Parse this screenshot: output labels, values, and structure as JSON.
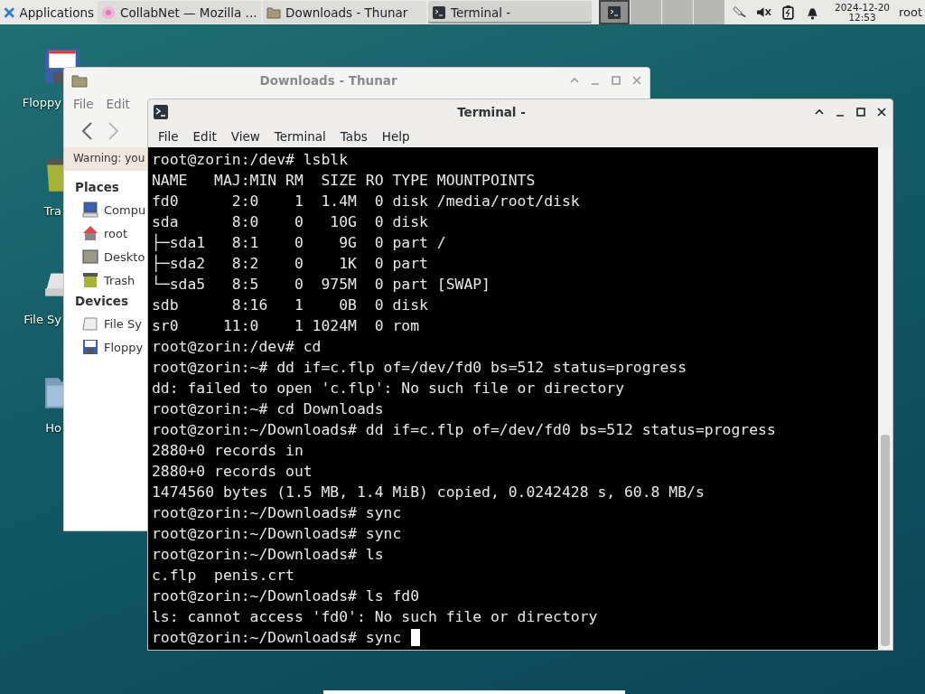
{
  "taskbar": {
    "applications": "Applications",
    "tasks": [
      {
        "label": "CollabNet — Mozilla ...",
        "kind": "browser",
        "selected": false
      },
      {
        "label": "Downloads - Thunar",
        "kind": "folder",
        "selected": false
      },
      {
        "label": "Terminal -",
        "kind": "terminal",
        "selected": true
      }
    ],
    "clock": {
      "date": "2024-12-20",
      "time": "12:53"
    },
    "user": "root"
  },
  "desktop_icons": [
    {
      "label": "Floppy",
      "kind": "floppy"
    },
    {
      "label": "Tra",
      "kind": "trash"
    },
    {
      "label": "File Sy",
      "kind": "drive"
    },
    {
      "label": "Ho",
      "kind": "folder"
    }
  ],
  "thunar": {
    "title": "Downloads - Thunar",
    "menu": [
      "File",
      "Edit"
    ],
    "warning": "Warning: you",
    "sidebar": [
      {
        "heading": "Places",
        "items": [
          {
            "label": "Compu",
            "kind": "computer"
          },
          {
            "label": "root",
            "kind": "home"
          },
          {
            "label": "Deskto",
            "kind": "desktop"
          },
          {
            "label": "Trash",
            "kind": "trash"
          }
        ]
      },
      {
        "heading": "Devices",
        "items": [
          {
            "label": "File Sy",
            "kind": "drive"
          },
          {
            "label": "Floppy",
            "kind": "floppy"
          }
        ]
      }
    ]
  },
  "terminal": {
    "title": "Terminal -",
    "menu": [
      "File",
      "Edit",
      "View",
      "Terminal",
      "Tabs",
      "Help"
    ],
    "lines": [
      "root@zorin:/dev# lsblk",
      "NAME   MAJ:MIN RM  SIZE RO TYPE MOUNTPOINTS",
      "fd0      2:0    1  1.4M  0 disk /media/root/disk",
      "sda      8:0    0   10G  0 disk",
      "├─sda1   8:1    0    9G  0 part /",
      "├─sda2   8:2    0    1K  0 part",
      "└─sda5   8:5    0  975M  0 part [SWAP]",
      "sdb      8:16   1    0B  0 disk",
      "sr0     11:0    1 1024M  0 rom",
      "root@zorin:/dev# cd",
      "root@zorin:~# dd if=c.flp of=/dev/fd0 bs=512 status=progress",
      "dd: failed to open 'c.flp': No such file or directory",
      "root@zorin:~# cd Downloads",
      "root@zorin:~/Downloads# dd if=c.flp of=/dev/fd0 bs=512 status=progress",
      "2880+0 records in",
      "2880+0 records out",
      "1474560 bytes (1.5 MB, 1.4 MiB) copied, 0.0242428 s, 60.8 MB/s",
      "root@zorin:~/Downloads# sync",
      "root@zorin:~/Downloads# sync",
      "root@zorin:~/Downloads# ls",
      "c.flp  penis.crt",
      "root@zorin:~/Downloads# ls fd0",
      "ls: cannot access 'fd0': No such file or directory",
      "root@zorin:~/Downloads# sync "
    ],
    "cursor": true
  }
}
